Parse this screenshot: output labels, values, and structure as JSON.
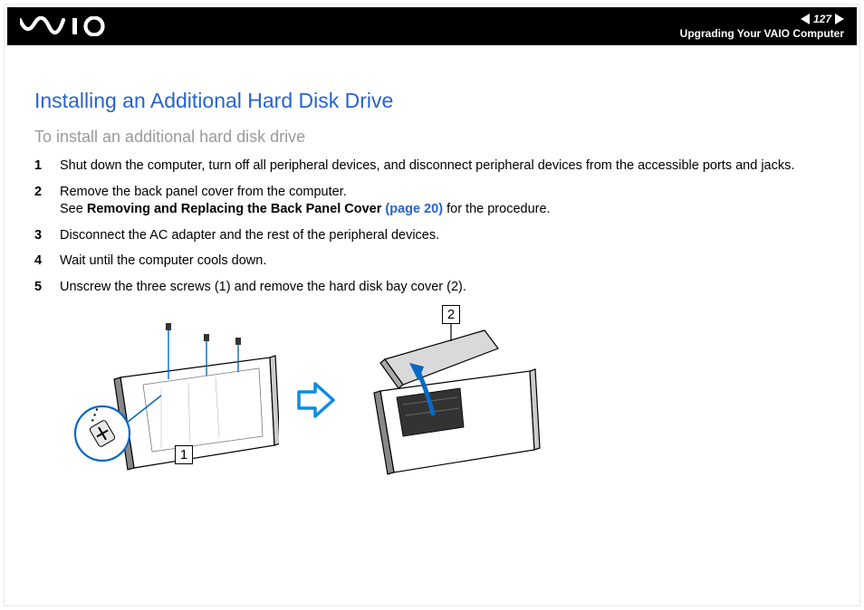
{
  "header": {
    "page_number": "127",
    "breadcrumb": "Upgrading Your VAIO Computer"
  },
  "content": {
    "title": "Installing an Additional Hard Disk Drive",
    "subtitle": "To install an additional hard disk drive",
    "steps": [
      {
        "num": "1",
        "text": "Shut down the computer, turn off all peripheral devices, and disconnect peripheral devices from the accessible ports and jacks."
      },
      {
        "num": "2",
        "text_before": "Remove the back panel cover from the computer.\nSee ",
        "bold": "Removing and Replacing the Back Panel Cover",
        "xref": " (page 20)",
        "text_after": " for the procedure."
      },
      {
        "num": "3",
        "text": "Disconnect the AC adapter and the rest of the peripheral devices."
      },
      {
        "num": "4",
        "text": "Wait until the computer cools down."
      },
      {
        "num": "5",
        "text": "Unscrew the three screws (1) and remove the hard disk bay cover (2)."
      }
    ]
  },
  "figure": {
    "callout1": "1",
    "callout2": "2"
  }
}
